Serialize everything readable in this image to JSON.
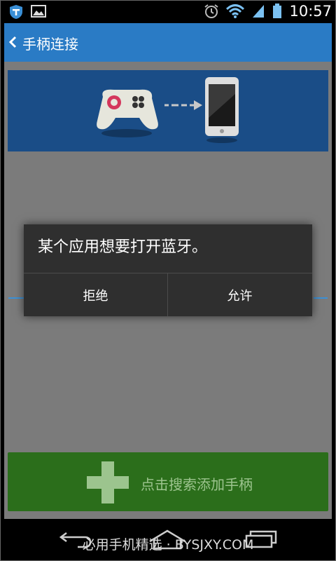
{
  "status_bar": {
    "time": "10:57",
    "icons": [
      "app-t-icon",
      "gallery-icon",
      "alarm-icon",
      "wifi-icon",
      "signal-icon",
      "battery-icon"
    ]
  },
  "appbar": {
    "title": "手柄连接",
    "color": "#2a7bc5"
  },
  "banner": {
    "color": "#1a4d87",
    "icons": [
      "gamepad-icon",
      "arrow-right-icon",
      "phone-icon"
    ]
  },
  "dialog": {
    "message": "某个应用想要打开蓝牙。",
    "deny_label": "拒绝",
    "allow_label": "允许"
  },
  "add_button": {
    "label": "点击搜索添加手柄",
    "color": "#2b6e1b"
  },
  "nav_bar": {
    "watermark": "必用手机精选 · BYSJXY.COM"
  }
}
